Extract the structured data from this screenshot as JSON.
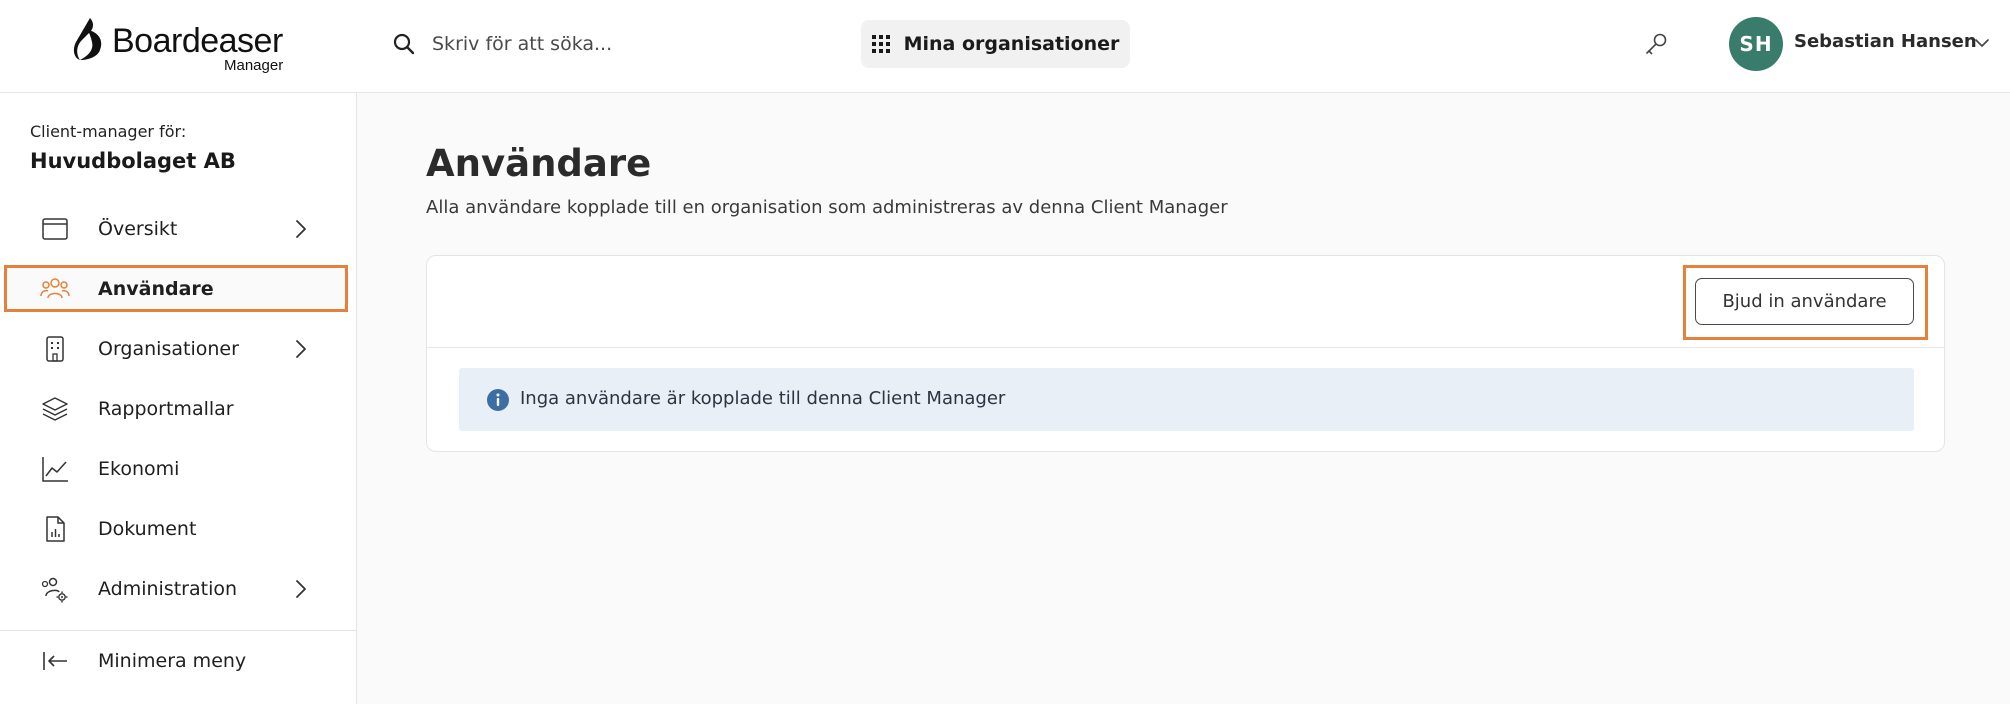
{
  "header": {
    "logo_name": "Boardeaser",
    "logo_sub": "Manager",
    "search_placeholder": "Skriv för att söka...",
    "org_button_label": "Mina organisationer",
    "user_initials": "SH",
    "user_name": "Sebastian Hansen"
  },
  "sidebar": {
    "client_manager_label": "Client-manager för:",
    "org_name": "Huvudbolaget AB",
    "items": [
      {
        "label": "Översikt",
        "icon": "browser-window-icon",
        "has_chevron": true
      },
      {
        "label": "Användare",
        "icon": "users-icon",
        "has_chevron": false,
        "active": true
      },
      {
        "label": "Organisationer",
        "icon": "building-icon",
        "has_chevron": true
      },
      {
        "label": "Rapportmallar",
        "icon": "layers-icon",
        "has_chevron": false
      },
      {
        "label": "Ekonomi",
        "icon": "line-chart-icon",
        "has_chevron": false
      },
      {
        "label": "Dokument",
        "icon": "document-chart-icon",
        "has_chevron": false
      },
      {
        "label": "Administration",
        "icon": "users-gear-icon",
        "has_chevron": true
      }
    ],
    "minimize_label": "Minimera meny"
  },
  "main": {
    "title": "Användare",
    "subtitle": "Alla användare kopplade till en organisation som administreras av denna Client Manager",
    "invite_button": "Bjud in användare",
    "info_message": "Inga användare är kopplade till denna Client Manager"
  },
  "colors": {
    "accent_highlight": "#e5813a",
    "avatar": "#3a7c6b",
    "info_bg": "#e8eff6",
    "info_icon": "#3d6ea3"
  }
}
